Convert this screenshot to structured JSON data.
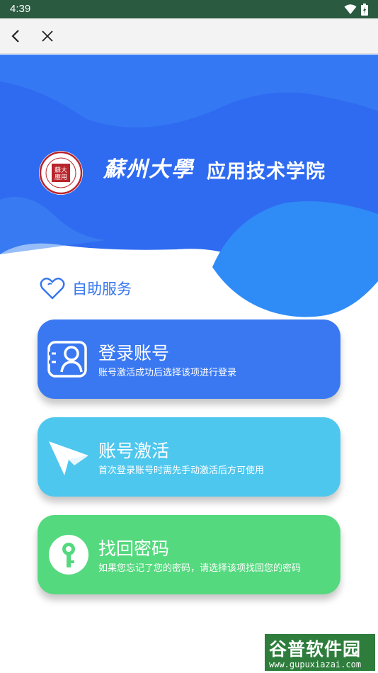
{
  "status_bar": {
    "time": "4:39",
    "icons": [
      "wifi-icon",
      "battery-charging-icon"
    ]
  },
  "nav": {
    "icons": [
      "back-arrow-icon",
      "close-icon"
    ]
  },
  "header": {
    "school_name": "蘇州大學",
    "college_name": "应用技术学院",
    "seal_text": "蘇州大學應用技術學院",
    "colors": {
      "primary": "#2f6bf0",
      "wave": "#3a86f5"
    }
  },
  "section": {
    "title": "自助服务",
    "icon": "heart-icon"
  },
  "cards": [
    {
      "title": "登录账号",
      "desc": "账号激活成功后选择该项进行登录",
      "icon": "id-card-icon",
      "color": "#3a78f2"
    },
    {
      "title": "账号激活",
      "desc": "首次登录账号时需先手动激活后方可使用",
      "icon": "paper-plane-icon",
      "color": "#4ec7ee"
    },
    {
      "title": "找回密码",
      "desc": "如果您忘记了您的密码，请选择该项找回您的密码",
      "icon": "key-icon",
      "color": "#55d97e"
    }
  ],
  "watermark": {
    "main": "谷普软件园",
    "url": "www.gupuxiazai.com"
  }
}
